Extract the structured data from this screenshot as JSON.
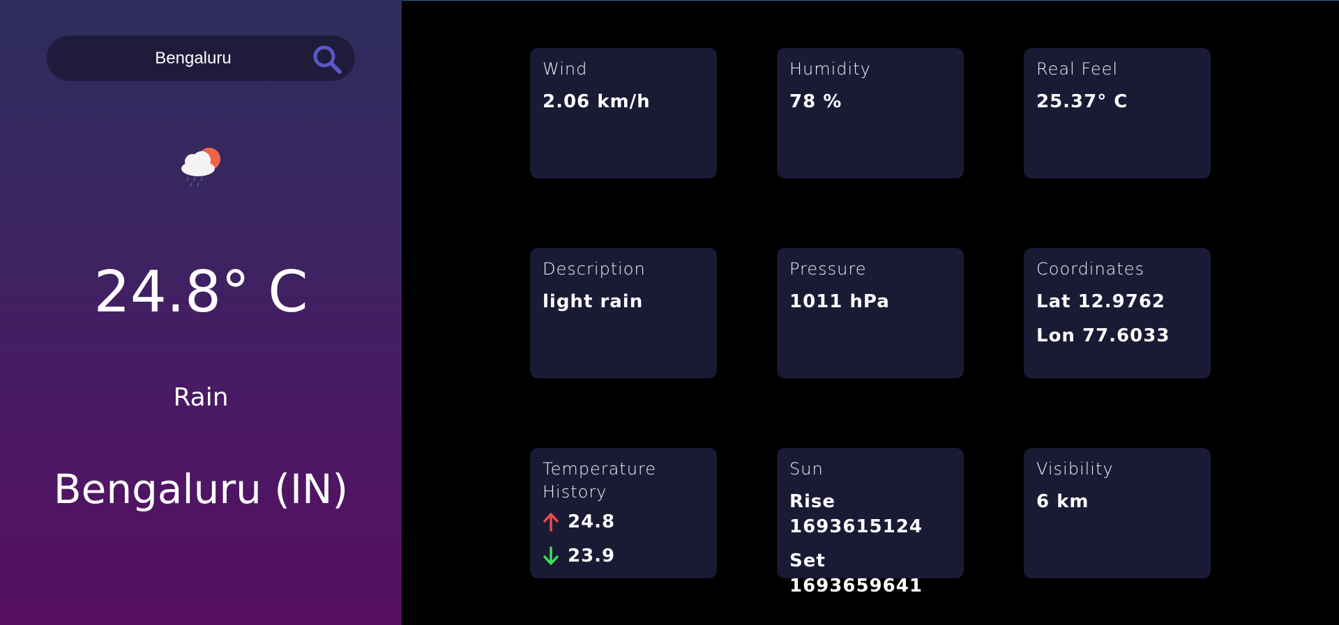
{
  "search": {
    "value": "Bengaluru"
  },
  "current": {
    "icon": "rain-cloud-sun-icon",
    "temperature": "24.8° C",
    "condition": "Rain",
    "city": "Bengaluru (IN)"
  },
  "cards": {
    "wind": {
      "title": "Wind",
      "value": "2.06 km/h"
    },
    "humidity": {
      "title": "Humidity",
      "value": "78 %"
    },
    "real_feel": {
      "title": "Real Feel",
      "value": "25.37° C"
    },
    "description": {
      "title": "Description",
      "value": "light rain"
    },
    "pressure": {
      "title": "Pressure",
      "value": "1011 hPa"
    },
    "coordinates": {
      "title": "Coordinates",
      "lat": "Lat 12.9762",
      "lon": "Lon 77.6033"
    },
    "temp_history": {
      "title": "Temperature History",
      "max": "24.8",
      "min": "23.9"
    },
    "sun": {
      "title": "Sun",
      "rise": "Rise 1693615124",
      "set": "Set 1693659641"
    },
    "visibility": {
      "title": "Visibility",
      "value": "6 km"
    }
  },
  "colors": {
    "accent": "#5b57c8",
    "up_arrow": "#ef4b4b",
    "down_arrow": "#3ee05a",
    "card_bg": "#1b1a35"
  }
}
